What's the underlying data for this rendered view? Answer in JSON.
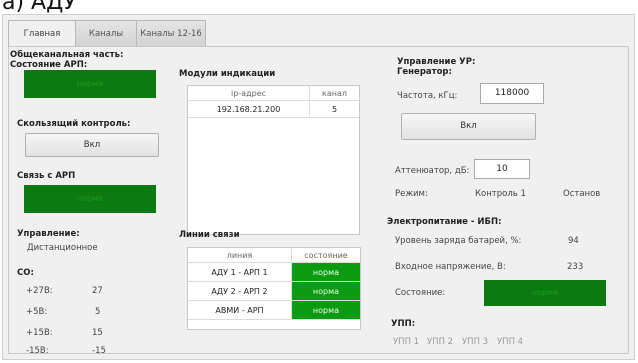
{
  "caption": "a) АДУ",
  "tabs": [
    {
      "label": "Главная"
    },
    {
      "label": "Каналы"
    },
    {
      "label": "Каналы 12-16"
    }
  ],
  "left": {
    "common_title": "Общеканальная часть:",
    "arp_state_label": "Состояние АРП:",
    "arp_state_value": "норма",
    "sliding_control_label": "Скользящий контроль:",
    "sliding_control_button": "Вкл",
    "arp_link_label": "Связь с АРП",
    "arp_link_value": "норма",
    "control_label": "Управление:",
    "control_value": "Дистанционное",
    "co_label": "СО:",
    "co_rows": [
      {
        "name": "+27В:",
        "value": "27"
      },
      {
        "name": "+5В:",
        "value": "5"
      },
      {
        "name": "+15В:",
        "value": "15"
      },
      {
        "name": "-15В:",
        "value": "-15"
      }
    ]
  },
  "indication": {
    "title": "Модули индикации",
    "headers": [
      "ip-адрес",
      "канал"
    ],
    "rows": [
      {
        "ip": "192.168.21.200",
        "channel": "5"
      }
    ]
  },
  "links": {
    "title": "Линии связи",
    "headers": [
      "линия",
      "состояние"
    ],
    "rows": [
      {
        "line": "АДУ 1 - АРП 1",
        "state": "норма"
      },
      {
        "line": "АДУ 2 - АРП 2",
        "state": "норма"
      },
      {
        "line": "АВМИ - АРП",
        "state": "норма"
      }
    ]
  },
  "right": {
    "ur_title": "Управление УР:",
    "generator_label": "Генератор:",
    "freq_label": "Частота, кГц:",
    "freq_value": "118000",
    "gen_button": "Вкл",
    "attenuator_label": "Аттенюатор, дБ:",
    "attenuator_value": "10",
    "mode_label": "Режим:",
    "mode_value": "Контроль 1",
    "stop_label": "Останов",
    "power_title": "Электропитание - ИБП:",
    "battery_label": "Уровень заряда батарей, %:",
    "battery_value": "94",
    "input_voltage_label": "Входное напряжение, В:",
    "input_voltage_value": "233",
    "state_label": "Состояние:",
    "state_value": "норма",
    "upp_title": "УПП:",
    "upp_items": [
      "УПП 1",
      "УПП 2",
      "УПП 3",
      "УПП 4"
    ]
  },
  "colors": {
    "status_green": "#0c7a10",
    "cell_green": "#0c9a10"
  }
}
